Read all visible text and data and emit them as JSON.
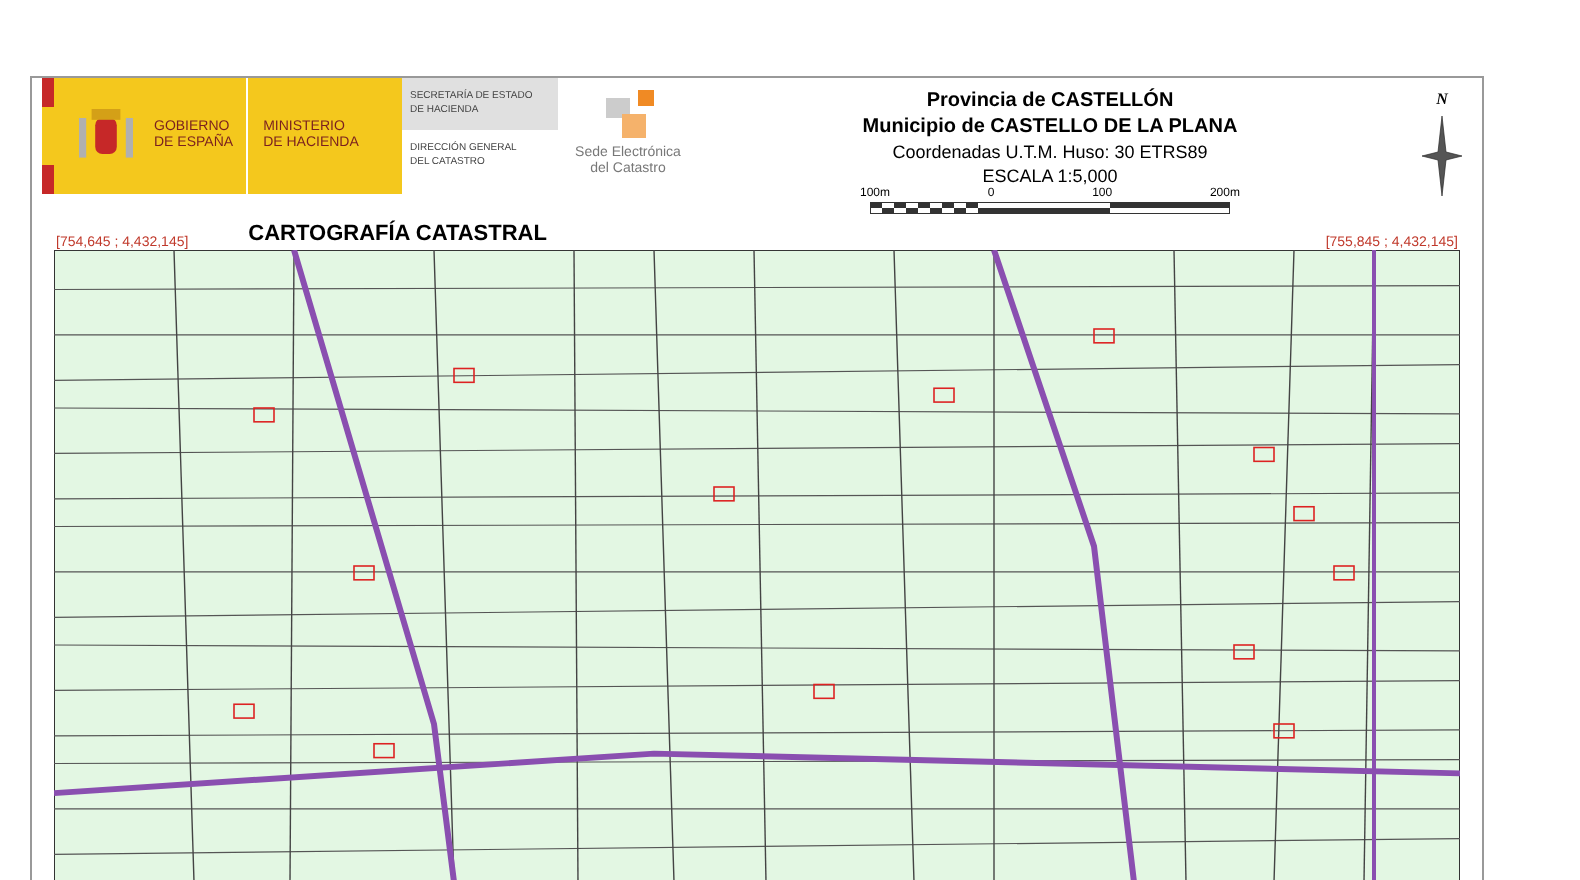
{
  "header": {
    "gov_lines": [
      "GOBIERNO",
      "DE ESPAÑA"
    ],
    "ministry_lines": [
      "MINISTERIO",
      "DE HACIENDA"
    ],
    "secretaria": [
      "SECRETARÍA DE ESTADO",
      "DE HACIENDA"
    ],
    "direccion": [
      "DIRECCIÓN GENERAL",
      "DEL CATASTRO"
    ],
    "sede": [
      "Sede Electrónica",
      "del Catastro"
    ],
    "province": "Provincia de CASTELLÓN",
    "municipality": "Municipio de CASTELLO DE LA PLANA",
    "coordinates": "Coordenadas U.T.M. Huso: 30 ETRS89",
    "scale": "ESCALA 1:5,000",
    "scale_labels": [
      "100m",
      "0",
      "100",
      "200m"
    ],
    "north": "N"
  },
  "map": {
    "title": "CARTOGRAFÍA CATASTRAL",
    "corner_left": "[754,645 ; 4,432,145]",
    "corner_right": "[755,845 ; 4,432,145]"
  }
}
